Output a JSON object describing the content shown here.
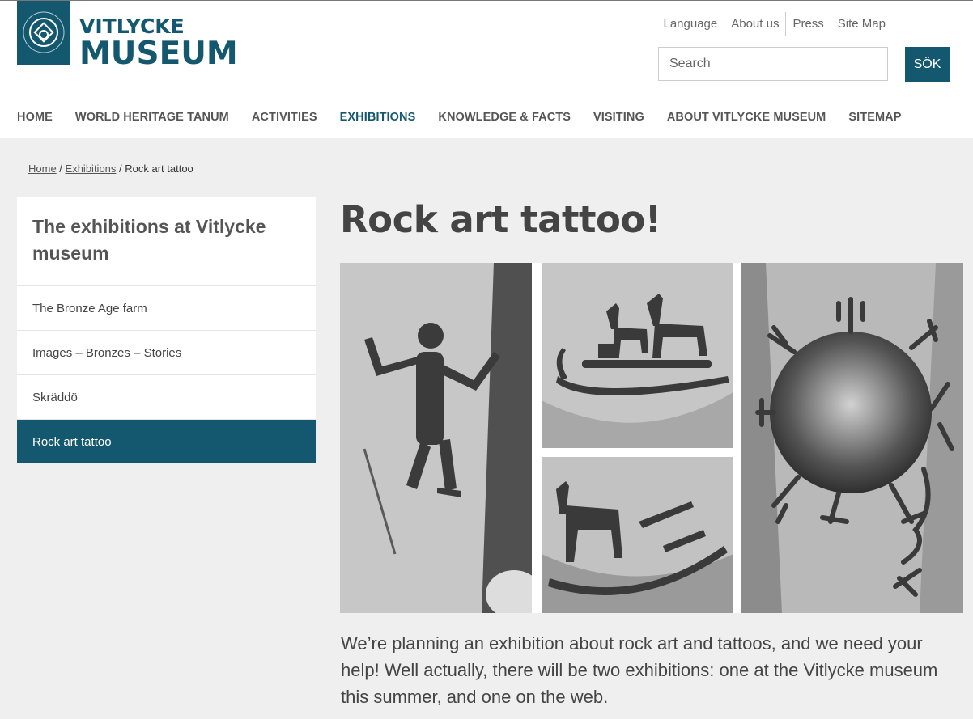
{
  "header": {
    "logo_line1": "VITLYCKE",
    "logo_line2": "MUSEUM",
    "util_links": [
      "Language",
      "About us",
      "Press",
      "Site Map"
    ],
    "search_placeholder": "Search",
    "search_button": "SÖK"
  },
  "main_nav": [
    {
      "label": "HOME",
      "active": false
    },
    {
      "label": "WORLD HERITAGE TANUM",
      "active": false
    },
    {
      "label": "ACTIVITIES",
      "active": false
    },
    {
      "label": "EXHIBITIONS",
      "active": true
    },
    {
      "label": "KNOWLEDGE & FACTS",
      "active": false
    },
    {
      "label": "VISITING",
      "active": false
    },
    {
      "label": "ABOUT VITLYCKE MUSEUM",
      "active": false
    },
    {
      "label": "SITEMAP",
      "active": false
    }
  ],
  "breadcrumb": {
    "home": "Home",
    "sep": " / ",
    "exhibitions": "Exhibitions",
    "current": "Rock art tattoo"
  },
  "sidebar": {
    "title": "The exhibitions at Vitlycke museum",
    "items": [
      {
        "label": "The Bronze Age farm",
        "active": false
      },
      {
        "label": "Images – Bronzes – Stories",
        "active": false
      },
      {
        "label": "Skräddö",
        "active": false
      },
      {
        "label": "Rock art tattoo",
        "active": true
      }
    ]
  },
  "article": {
    "title": "Rock art tattoo!",
    "intro": "We’re planning an exhibition about rock art and tattoos, and we need your help! Well actually, there will be two exhibitions: one at the Vitlycke museum this summer, and one on the web."
  },
  "colors": {
    "brand": "#14586f",
    "background": "#efefef"
  },
  "icons": {
    "logo": "unesco-world-heritage-emblem"
  }
}
